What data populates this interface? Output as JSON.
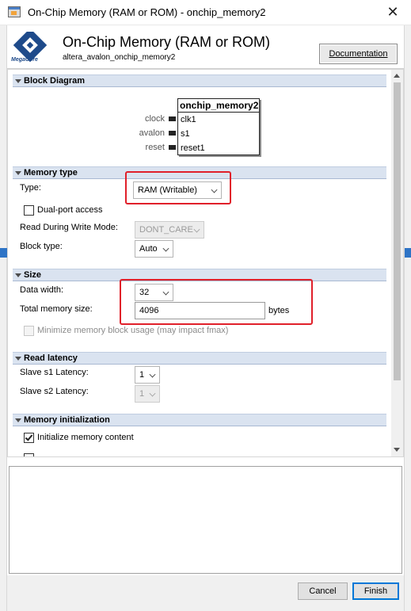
{
  "window": {
    "title": "On-Chip Memory (RAM or ROM) - onchip_memory2",
    "close_glyph": "✕"
  },
  "header": {
    "logo_text": "MegaCore",
    "title": "On-Chip Memory (RAM or ROM)",
    "subtitle": "altera_avalon_onchip_memory2",
    "documentation_label": "Documentation"
  },
  "block_diagram": {
    "heading": "Block Diagram",
    "component_name": "onchip_memory2",
    "interfaces": [
      "clock",
      "avalon",
      "reset"
    ],
    "ports": [
      "clk1",
      "s1",
      "reset1"
    ]
  },
  "memory_type": {
    "heading": "Memory type",
    "type_label": "Type:",
    "type_value": "RAM (Writable)",
    "dual_port_label": "Dual-port access",
    "dual_port_checked": false,
    "rdw_label": "Read During Write Mode:",
    "rdw_value": "DONT_CARE",
    "block_type_label": "Block type:",
    "block_type_value": "Auto"
  },
  "size": {
    "heading": "Size",
    "data_width_label": "Data width:",
    "data_width_value": "32",
    "total_size_label": "Total memory size:",
    "total_size_value": "4096",
    "total_size_unit": "bytes",
    "minimize_label": "Minimize memory block usage (may impact fmax)",
    "minimize_checked": false
  },
  "read_latency": {
    "heading": "Read latency",
    "s1_label": "Slave s1 Latency:",
    "s1_value": "1",
    "s2_label": "Slave s2 Latency:",
    "s2_value": "1"
  },
  "memory_init": {
    "heading": "Memory initialization",
    "init_label": "Initialize memory content",
    "init_checked": true
  },
  "footer": {
    "cancel_label": "Cancel",
    "finish_label": "Finish"
  },
  "colors": {
    "highlight": "#e0202a",
    "section_header": "#dae3f0",
    "primary_border": "#0078d7",
    "logo_blue": "#1e4a8a"
  },
  "icons": [
    "app-icon",
    "megacore-logo",
    "close-icon",
    "collapse-triangle-icon",
    "chevron-down-icon",
    "checkmark-icon"
  ]
}
